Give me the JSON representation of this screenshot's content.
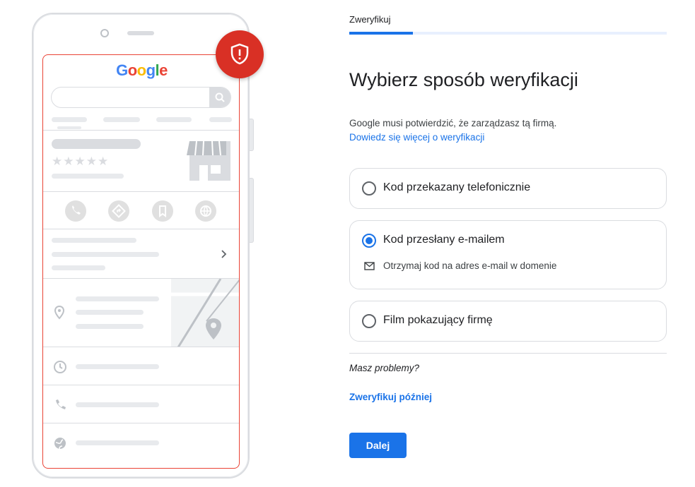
{
  "illustration": {
    "logo_letters": [
      {
        "char": "G",
        "color": "#4285f4"
      },
      {
        "char": "o",
        "color": "#ea4335"
      },
      {
        "char": "o",
        "color": "#fbbc05"
      },
      {
        "char": "g",
        "color": "#4285f4"
      },
      {
        "char": "l",
        "color": "#34a853"
      },
      {
        "char": "e",
        "color": "#ea4335"
      }
    ],
    "stars": "★★★★★",
    "badge_icon": "shield-alert-icon",
    "accent_color": "#ea4335"
  },
  "stepper": {
    "step_label": "Zweryfikuj",
    "progress_fraction": 0.2
  },
  "page": {
    "title": "Wybierz sposób weryfikacji",
    "description": "Google musi potwierdzić, że zarządzasz tą firmą.",
    "learn_more_link": "Dowiedz się więcej o weryfikacji"
  },
  "options": [
    {
      "label": "Kod przekazany telefonicznie",
      "selected": false
    },
    {
      "label": "Kod przesłany e-mailem",
      "selected": true,
      "detail": "Otrzymaj kod na adres e-mail w domenie",
      "detail_icon": "mail-icon"
    },
    {
      "label": "Film pokazujący firmę",
      "selected": false
    }
  ],
  "footer": {
    "problems_text": "Masz problemy?",
    "verify_later_link": "Zweryfikuj później",
    "next_button": "Dalej"
  },
  "colors": {
    "primary": "#1a73e8",
    "border": "#dadce0",
    "badge_red": "#d93025"
  }
}
